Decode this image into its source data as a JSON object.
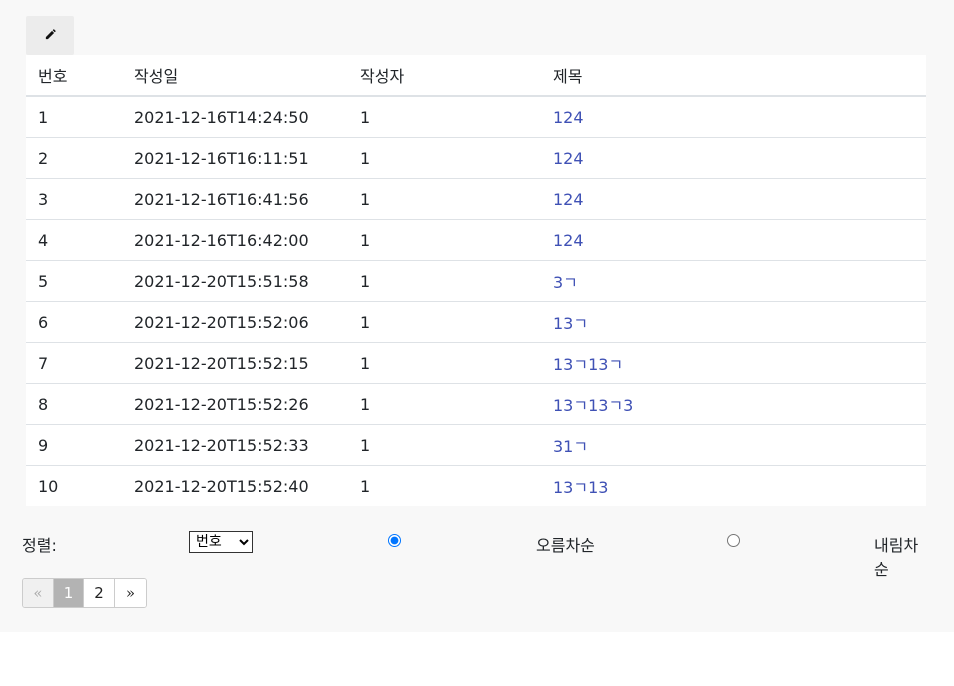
{
  "toolbar": {
    "write_icon": "pencil-icon"
  },
  "table": {
    "headers": [
      "번호",
      "작성일",
      "작성자",
      "제목"
    ],
    "rows": [
      {
        "no": "1",
        "date": "2021-12-16T14:24:50",
        "author": "1",
        "title": "124"
      },
      {
        "no": "2",
        "date": "2021-12-16T16:11:51",
        "author": "1",
        "title": "124"
      },
      {
        "no": "3",
        "date": "2021-12-16T16:41:56",
        "author": "1",
        "title": "124"
      },
      {
        "no": "4",
        "date": "2021-12-16T16:42:00",
        "author": "1",
        "title": "124"
      },
      {
        "no": "5",
        "date": "2021-12-20T15:51:58",
        "author": "1",
        "title": "3ㄱ"
      },
      {
        "no": "6",
        "date": "2021-12-20T15:52:06",
        "author": "1",
        "title": "13ㄱ"
      },
      {
        "no": "7",
        "date": "2021-12-20T15:52:15",
        "author": "1",
        "title": "13ㄱ13ㄱ"
      },
      {
        "no": "8",
        "date": "2021-12-20T15:52:26",
        "author": "1",
        "title": "13ㄱ13ㄱ3"
      },
      {
        "no": "9",
        "date": "2021-12-20T15:52:33",
        "author": "1",
        "title": "31ㄱ"
      },
      {
        "no": "10",
        "date": "2021-12-20T15:52:40",
        "author": "1",
        "title": "13ㄱ13"
      }
    ]
  },
  "sort": {
    "label": "정렬:",
    "selected": "번호",
    "asc_label": "오름차순",
    "desc_label": "내림차순",
    "asc_checked": true
  },
  "pagination": {
    "prev": "«",
    "pages": [
      "1",
      "2"
    ],
    "current": "1",
    "next": "»"
  },
  "colors": {
    "link": "#3f51b5",
    "current_page_bg": "#b3b3b3"
  }
}
